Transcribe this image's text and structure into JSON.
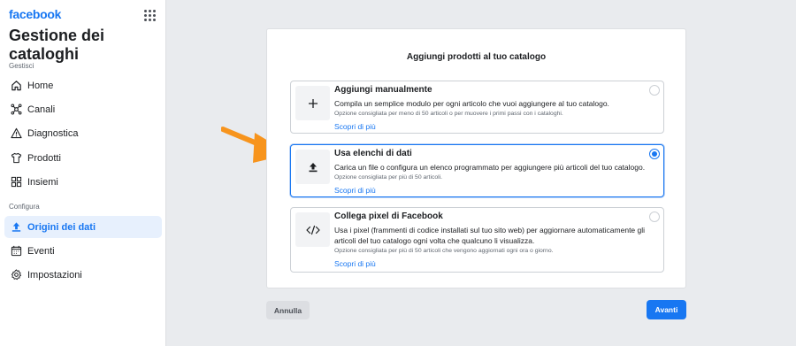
{
  "brand": "facebook",
  "app_title": "Gestione dei cataloghi",
  "sidebar": {
    "section_manage": "Gestisci",
    "section_configure": "Configura",
    "items": [
      {
        "label": "Home",
        "icon": "home-icon"
      },
      {
        "label": "Canali",
        "icon": "channels-icon"
      },
      {
        "label": "Diagnostica",
        "icon": "warning-icon"
      },
      {
        "label": "Prodotti",
        "icon": "shirt-icon"
      },
      {
        "label": "Insiemi",
        "icon": "sets-icon"
      },
      {
        "label": "Origini dei dati",
        "icon": "upload-icon",
        "active": true
      },
      {
        "label": "Eventi",
        "icon": "calendar-icon"
      },
      {
        "label": "Impostazioni",
        "icon": "gear-icon"
      }
    ]
  },
  "main": {
    "title": "Aggiungi prodotti al tuo catalogo",
    "options": [
      {
        "title": "Aggiungi manualmente",
        "description": "Compila un semplice modulo per ogni articolo che vuoi aggiungere al tuo catalogo.",
        "hint": "Opzione consigliata per meno di 50 articoli o per muovere i primi passi con i cataloghi.",
        "link": "Scopri di più",
        "icon": "plus-icon",
        "selected": false
      },
      {
        "title": "Usa elenchi di dati",
        "description": "Carica un file o configura un elenco programmato per aggiungere più articoli del tuo catalogo.",
        "hint": "Opzione consigliata per più di 50 articoli.",
        "link": "Scopri di più",
        "icon": "upload-icon",
        "selected": true
      },
      {
        "title": "Collega pixel di Facebook",
        "description": "Usa i pixel (frammenti di codice installati sul tuo sito web) per aggiornare automaticamente gli articoli del tuo catalogo ogni volta che qualcuno li visualizza.",
        "hint": "Opzione consigliata per più di 50 articoli che vengono aggiornati ogni ora o giorno.",
        "link": "Scopri di più",
        "icon": "code-icon",
        "selected": false
      }
    ],
    "cancel_label": "Annulla",
    "next_label": "Avanti"
  },
  "colors": {
    "accent": "#1877f2",
    "arrow": "#f7941d"
  }
}
